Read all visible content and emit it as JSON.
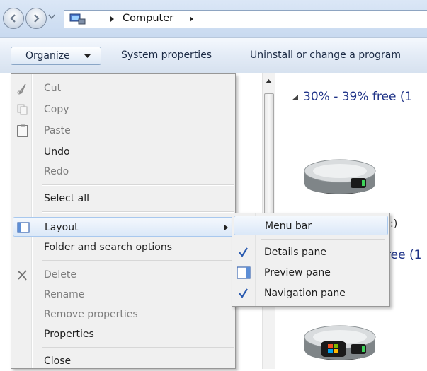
{
  "address_bar": {
    "crumbs": [
      "Computer"
    ],
    "back_icon": "back-arrow-icon",
    "forward_icon": "forward-arrow-icon",
    "location_icon": "computer-icon"
  },
  "toolbar": {
    "organize_label": "Organize",
    "system_properties_label": "System properties",
    "uninstall_label": "Uninstall or change a program"
  },
  "content": {
    "group_header": "30% - 39% free (1",
    "second_free_fragment": "ree (1",
    "drive_label_fragment": ":)"
  },
  "organize_menu": {
    "items": [
      {
        "label": "Cut",
        "enabled": false,
        "icon": "scissors-icon"
      },
      {
        "label": "Copy",
        "enabled": false,
        "icon": "copy-icon"
      },
      {
        "label": "Paste",
        "enabled": false,
        "icon": "clipboard-icon"
      },
      {
        "label": "Undo",
        "enabled": true
      },
      {
        "label": "Redo",
        "enabled": false
      },
      {
        "label": "Select all",
        "enabled": true
      },
      {
        "label": "Layout",
        "enabled": true,
        "icon": "layout-icon",
        "has_submenu": true,
        "highlighted": true
      },
      {
        "label": "Folder and search options",
        "enabled": true
      },
      {
        "label": "Delete",
        "enabled": false,
        "icon": "delete-x-icon"
      },
      {
        "label": "Rename",
        "enabled": false
      },
      {
        "label": "Remove properties",
        "enabled": false
      },
      {
        "label": "Properties",
        "enabled": true
      },
      {
        "label": "Close",
        "enabled": true
      }
    ]
  },
  "layout_submenu": {
    "items": [
      {
        "label": "Menu bar",
        "checked": false,
        "highlighted": true
      },
      {
        "label": "Details pane",
        "checked": true
      },
      {
        "label": "Preview pane",
        "checked": false,
        "icon": "preview-pane-icon"
      },
      {
        "label": "Navigation pane",
        "checked": true
      }
    ]
  },
  "colors": {
    "group_header": "#1e3287",
    "highlight_border": "#a8c8ee",
    "check_mark": "#2b5bb0"
  }
}
